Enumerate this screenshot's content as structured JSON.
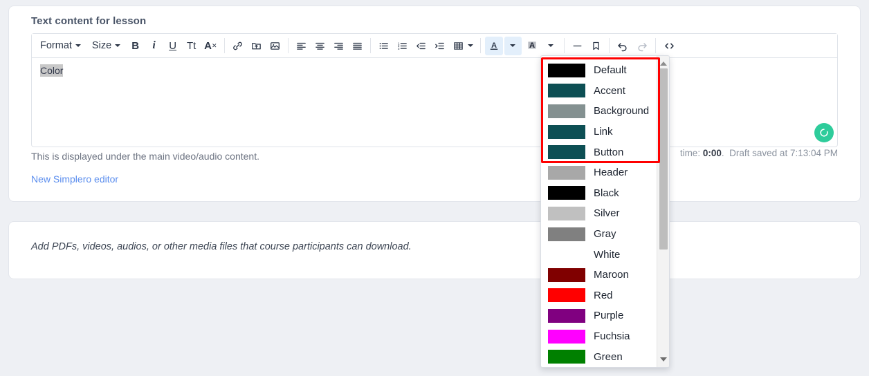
{
  "section": {
    "title": "Text content for lesson",
    "helper_text": "This is displayed under the main video/audio content.",
    "editor_link": "New Simplero editor"
  },
  "editor": {
    "content": "Color",
    "selected_text": "Color"
  },
  "toolbar": {
    "format_label": "Format",
    "size_label": "Size",
    "bold_label": "B",
    "italic_label": "i",
    "underline_label": "U",
    "text_style_label": "Tt",
    "clear_format_label": "A",
    "icons": [
      "link-icon",
      "insert-file-icon",
      "insert-image-icon",
      "align-left-icon",
      "align-center-icon",
      "align-right-icon",
      "align-justify-icon",
      "bullet-list-icon",
      "numbered-list-icon",
      "outdent-icon",
      "indent-icon",
      "table-icon",
      "text-color-icon",
      "background-color-icon",
      "horizontal-rule-icon",
      "bookmark-icon",
      "undo-icon",
      "redo-icon",
      "source-code-icon"
    ]
  },
  "status": {
    "prefix": "time:",
    "time_value": "0:00",
    "separator": ".",
    "saved_text": "Draft saved at 7:13:04 PM",
    "spinner_color": "#2ecc9b"
  },
  "media_card": {
    "hint": "Add PDFs, videos, audios, or other media files that course participants can download."
  },
  "color_menu": {
    "highlight_color": "#ff0000",
    "items": [
      {
        "label": "Default",
        "color": "#000000"
      },
      {
        "label": "Accent",
        "color": "#0d4f54"
      },
      {
        "label": "Background",
        "color": "#849191"
      },
      {
        "label": "Link",
        "color": "#0d4f54"
      },
      {
        "label": "Button",
        "color": "#0d4f54"
      },
      {
        "label": "Header",
        "color": "#a8a8a8"
      },
      {
        "label": "Black",
        "color": "#000000"
      },
      {
        "label": "Silver",
        "color": "#c0c0c0"
      },
      {
        "label": "Gray",
        "color": "#808080"
      },
      {
        "label": "White",
        "color": "#ffffff"
      },
      {
        "label": "Maroon",
        "color": "#800000"
      },
      {
        "label": "Red",
        "color": "#ff0000"
      },
      {
        "label": "Purple",
        "color": "#800080"
      },
      {
        "label": "Fuchsia",
        "color": "#ff00ff"
      },
      {
        "label": "Green",
        "color": "#008000"
      }
    ]
  }
}
